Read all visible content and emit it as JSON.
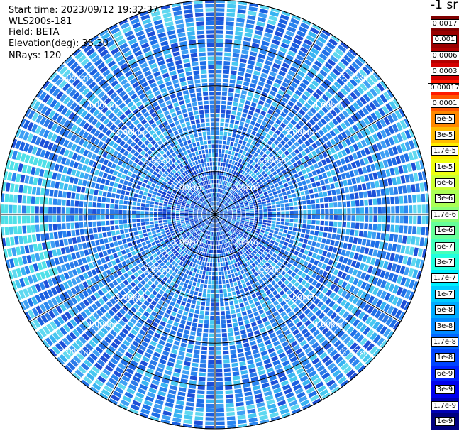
{
  "header": {
    "start_time": "Start time: 2023/09/12 19:32:37",
    "instrument": "WLS200s-181",
    "field": "Field: BETA",
    "elevation": "Elevation(deg): 35.30",
    "nrays": "NRays: 120"
  },
  "colorbar": {
    "units": "-1 sr",
    "entries": [
      {
        "label": "0.0017",
        "color": "#7f0000"
      },
      {
        "label": "0.001",
        "color": "#990000"
      },
      {
        "label": "0.0006",
        "color": "#b30000"
      },
      {
        "label": "0.0003",
        "color": "#d40000"
      },
      {
        "label": "0.00017",
        "color": "#ff1a00"
      },
      {
        "label": "0.0001",
        "color": "#ff5500"
      },
      {
        "label": "6e-5",
        "color": "#ff8800"
      },
      {
        "label": "3e-5",
        "color": "#ffbb00"
      },
      {
        "label": "1.7e-5",
        "color": "#ffee00"
      },
      {
        "label": "1e-5",
        "color": "#eeff11"
      },
      {
        "label": "6e-6",
        "color": "#ccff33"
      },
      {
        "label": "3e-6",
        "color": "#aaff55"
      },
      {
        "label": "1.7e-6",
        "color": "#88ff77"
      },
      {
        "label": "1e-6",
        "color": "#66ff99"
      },
      {
        "label": "6e-7",
        "color": "#44ffbb"
      },
      {
        "label": "3e-7",
        "color": "#22ffdd"
      },
      {
        "label": "1.7e-7",
        "color": "#00eeff"
      },
      {
        "label": "1e-7",
        "color": "#00ccff"
      },
      {
        "label": "6e-8",
        "color": "#00aaff"
      },
      {
        "label": "3e-8",
        "color": "#0088ff"
      },
      {
        "label": "1.7e-8",
        "color": "#0066ff"
      },
      {
        "label": "1e-8",
        "color": "#0044ff"
      },
      {
        "label": "6e-9",
        "color": "#0022ff"
      },
      {
        "label": "3e-9",
        "color": "#0000ee"
      },
      {
        "label": "1.7e-9",
        "color": "#0000b3"
      },
      {
        "label": "1e-9",
        "color": "#000080"
      }
    ]
  },
  "chart_data": {
    "type": "heatmap",
    "projection": "polar",
    "field": "BETA",
    "range_rings_km": [
      1,
      2,
      3,
      4,
      5
    ],
    "ring_labels": [
      "1.00km",
      "2.00km",
      "3.00km",
      "4.00km",
      "5.00km"
    ],
    "max_range_km": 5.0,
    "azimuth_spokes_deg": [
      0,
      30,
      60,
      90,
      120,
      150,
      180,
      210,
      240,
      270,
      300,
      330
    ],
    "nrays": 120,
    "dominant_values": [
      3e-08,
      6e-08,
      1e-07,
      1.7e-07
    ],
    "color_scale": "log"
  }
}
